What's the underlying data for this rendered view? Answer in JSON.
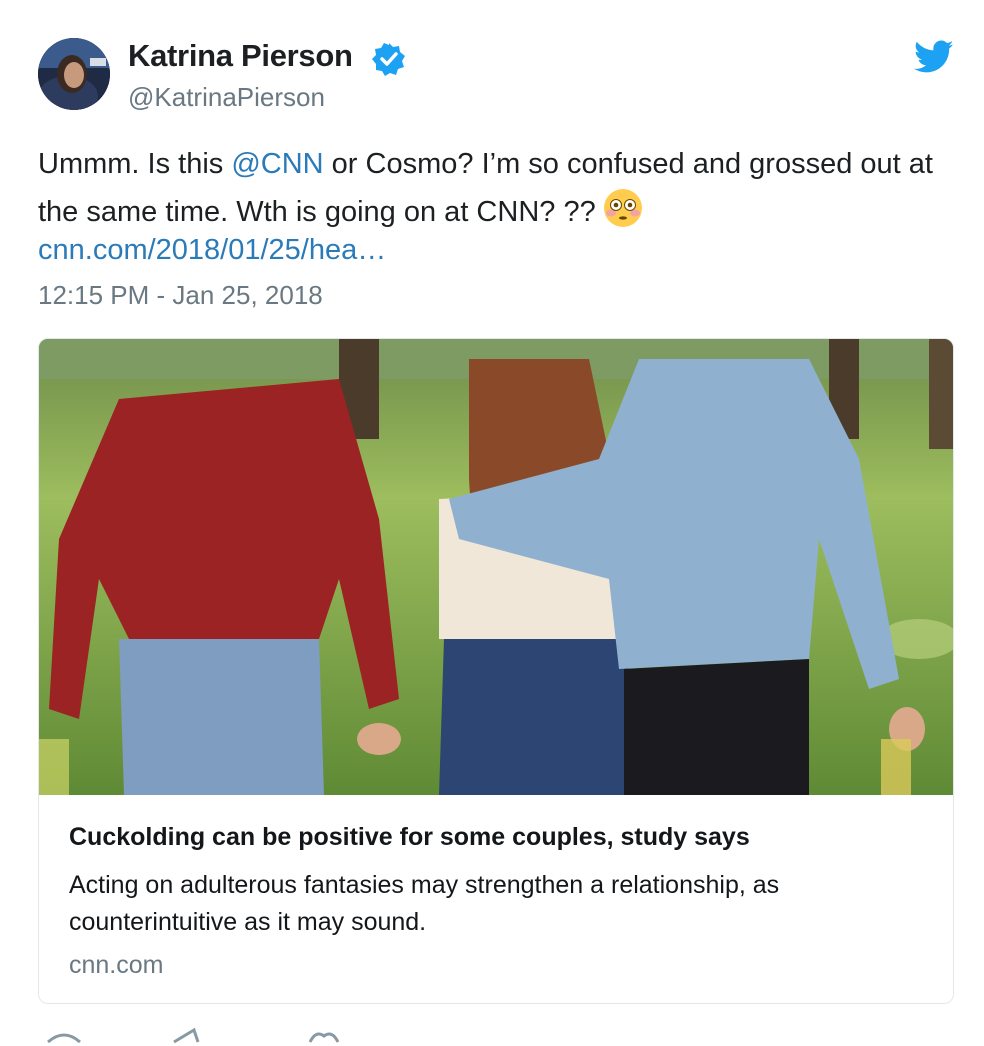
{
  "author": {
    "name": "Katrina Pierson",
    "handle": "@KatrinaPierson",
    "avatar_icon": "profile-photo",
    "verified_icon": "verified-badge-icon"
  },
  "tweet": {
    "text_before": "Ummm. Is this ",
    "mention": "@CNN",
    "text_after": " or Cosmo? I’m so confused and grossed out at the same time. Wth is going on at CNN? ??",
    "emoji_icon": "flushed-face-emoji",
    "link": "cnn.com/2018/01/25/hea…",
    "timestamp": "12:15 PM - Jan 25, 2018"
  },
  "card": {
    "title": "Cuckolding can be positive for some couples, study says",
    "description": "Acting on adulterous fantasies may strengthen a relationship, as counterintuitive as it may sound.",
    "domain": "cnn.com"
  },
  "colors": {
    "link": "#2b7bb9",
    "secondary_text": "#697882",
    "twitter_blue": "#1da1f2",
    "border": "#e1e8ed"
  }
}
